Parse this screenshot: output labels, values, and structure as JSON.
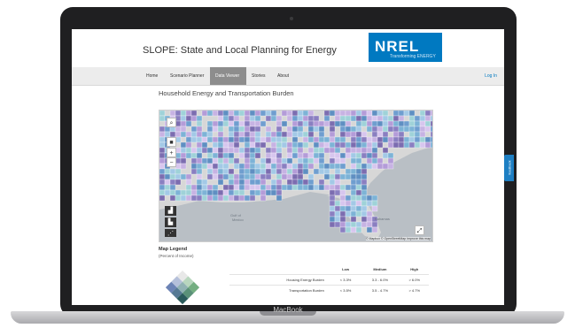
{
  "site": {
    "title": "SLOPE: State and Local Planning for Energy",
    "logo_text": "NREL",
    "logo_tagline": "Transforming ENERGY"
  },
  "nav": {
    "items": [
      {
        "label": "Home"
      },
      {
        "label": "Scenario Planner"
      },
      {
        "label": "Data Viewer",
        "active": true
      },
      {
        "label": "Stories"
      },
      {
        "label": "About"
      }
    ],
    "login_label": "Log In"
  },
  "page": {
    "section_title": "Household Energy and Transportation Burden"
  },
  "map": {
    "labels": {
      "gulf": "Gulf of",
      "gulf2": "Mexico",
      "bahamas": "Bahamas"
    },
    "attribution": "© Mapbox © OpenStreetMap  Improve this map",
    "controls": {
      "search_icon": "search-icon",
      "zoom_in": "+",
      "zoom_out": "−"
    }
  },
  "legend": {
    "title": "Map Legend",
    "subtitle": "(Percent of Income)",
    "columns": [
      "",
      "Low",
      "Medium",
      "High"
    ],
    "rows": [
      {
        "label": "Housing Energy Burden",
        "low": "< 3.3%",
        "medium": "3.3 - 6.0%",
        "high": "> 6.0%"
      },
      {
        "label": "Transportation Burden",
        "low": "< 3.5%",
        "medium": "3.5 - 4.7%",
        "high": "> 4.7%"
      }
    ]
  },
  "device": {
    "brand": "MacBook"
  },
  "feedback": {
    "label": "feedback"
  },
  "colors": {
    "nrel_blue": "#0079c1",
    "nav_active": "#8d8d8d",
    "water": "#b9bfc5",
    "land": "#d7d7d7"
  }
}
